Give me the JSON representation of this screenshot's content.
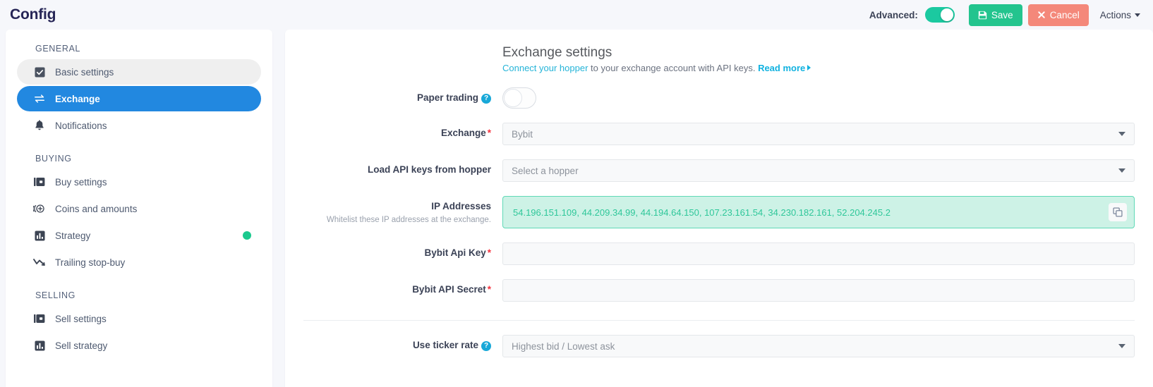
{
  "topbar": {
    "app_title": "Config",
    "advanced_label": "Advanced:",
    "advanced_on": true,
    "save_label": "Save",
    "cancel_label": "Cancel",
    "actions_label": "Actions",
    "save_color": "#23c48e",
    "cancel_color": "#f4887a",
    "toggle_on_color": "#1bc9a0"
  },
  "sidebar": {
    "groups": [
      {
        "title": "GENERAL",
        "items": [
          {
            "label": "Basic settings",
            "icon": "checkbox-checked-icon",
            "state": "hovered"
          },
          {
            "label": "Exchange",
            "icon": "exchange-arrows-icon",
            "state": "active"
          },
          {
            "label": "Notifications",
            "icon": "bell-icon",
            "state": "normal"
          }
        ]
      },
      {
        "title": "BUYING",
        "items": [
          {
            "label": "Buy settings",
            "icon": "wallet-icon",
            "state": "normal"
          },
          {
            "label": "Coins and amounts",
            "icon": "coin-plus-icon",
            "state": "normal"
          },
          {
            "label": "Strategy",
            "icon": "bar-chart-icon",
            "state": "normal",
            "badge": "green-dot"
          },
          {
            "label": "Trailing stop-buy",
            "icon": "trend-down-icon",
            "state": "normal"
          }
        ]
      },
      {
        "title": "SELLING",
        "items": [
          {
            "label": "Sell settings",
            "icon": "wallet-icon",
            "state": "normal"
          },
          {
            "label": "Sell strategy",
            "icon": "bar-chart-icon",
            "state": "normal"
          }
        ]
      }
    ],
    "badge_color": "#1bc98e",
    "active_color": "#2288e0"
  },
  "panel": {
    "title": "Exchange settings",
    "subtitle_link": "Connect your hopper",
    "subtitle_text": " to your exchange account with API keys. ",
    "subtitle_read_more": "Read more",
    "link_color": "#25b4d8"
  },
  "form": {
    "paper_trading": {
      "label": "Paper trading",
      "help": "?",
      "toggle_on": false
    },
    "exchange": {
      "label": "Exchange",
      "required": "*",
      "value": "Bybit"
    },
    "load_api_keys": {
      "label": "Load API keys from hopper",
      "value": "Select a hopper"
    },
    "ip_addresses": {
      "label": "IP Addresses",
      "note": "Whitelist these IP addresses at the exchange.",
      "value": "54.196.151.109, 44.209.34.99, 44.194.64.150, 107.23.161.54, 34.230.182.161, 52.204.245.2",
      "copy_icon": "copy-icon",
      "box_color": "#cdf2e6",
      "text_color": "#2fc79a"
    },
    "api_key": {
      "label": "Bybit Api Key",
      "required": "*",
      "value": ""
    },
    "api_secret": {
      "label": "Bybit API Secret",
      "required": "*",
      "value": ""
    },
    "ticker_rate": {
      "label": "Use ticker rate",
      "help": "?",
      "value": "Highest bid / Lowest ask"
    }
  }
}
